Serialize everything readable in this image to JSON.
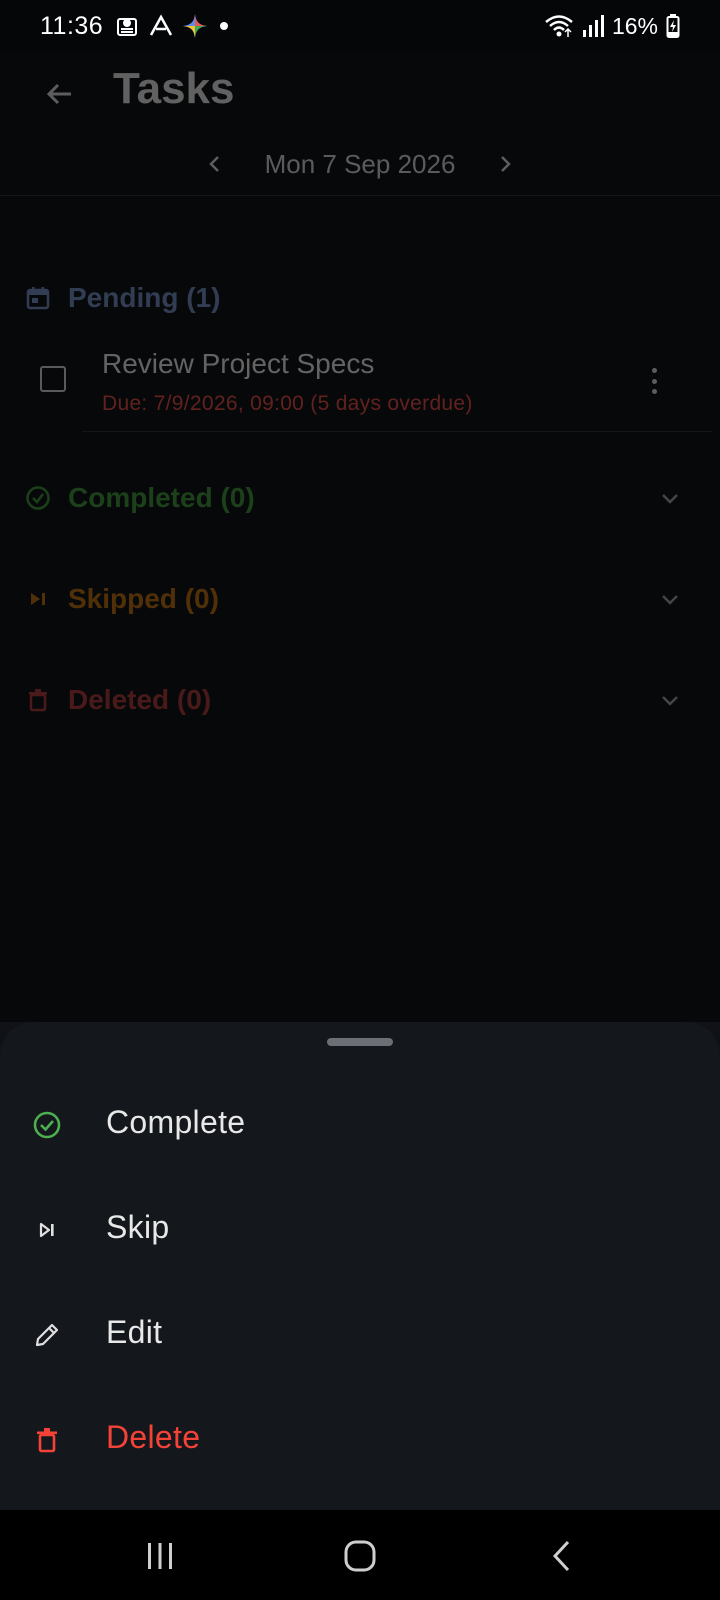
{
  "status_bar": {
    "time": "11:36",
    "battery_percent": "16%",
    "left_icons": [
      "notification-icon",
      "app-a-icon",
      "sparkle-icon",
      "dot-icon"
    ],
    "right_icons": [
      "wifi-icon",
      "signal-icon",
      "battery-charging-icon"
    ]
  },
  "app_bar": {
    "title": "Tasks",
    "date": "Mon 7 Sep 2026"
  },
  "sections": {
    "pending": {
      "label": "Pending (1)",
      "color": "#6f86b8"
    },
    "completed": {
      "label": "Completed (0)",
      "color": "#3f8f3a"
    },
    "skipped": {
      "label": "Skipped (0)",
      "color": "#b36a12"
    },
    "deleted": {
      "label": "Deleted (0)",
      "color": "#a33a38"
    }
  },
  "task": {
    "title": "Review Project Specs",
    "due": "Due: 7/9/2026, 09:00 (5 days overdue)",
    "checked": false
  },
  "sheet": {
    "items": [
      {
        "label": "Complete",
        "icon": "check-circle-icon",
        "color": "#e8e8e8",
        "icon_color": "#4caf50"
      },
      {
        "label": "Skip",
        "icon": "skip-next-icon",
        "color": "#e8e8e8",
        "icon_color": "#e0e0e0"
      },
      {
        "label": "Edit",
        "icon": "pencil-icon",
        "color": "#e8e8e8",
        "icon_color": "#e0e0e0"
      },
      {
        "label": "Delete",
        "icon": "trash-icon",
        "color": "#f44336",
        "icon_color": "#f44336"
      }
    ]
  },
  "colors": {
    "background": "#101217",
    "sheet": "#14171c",
    "overdue": "#d84a44"
  }
}
